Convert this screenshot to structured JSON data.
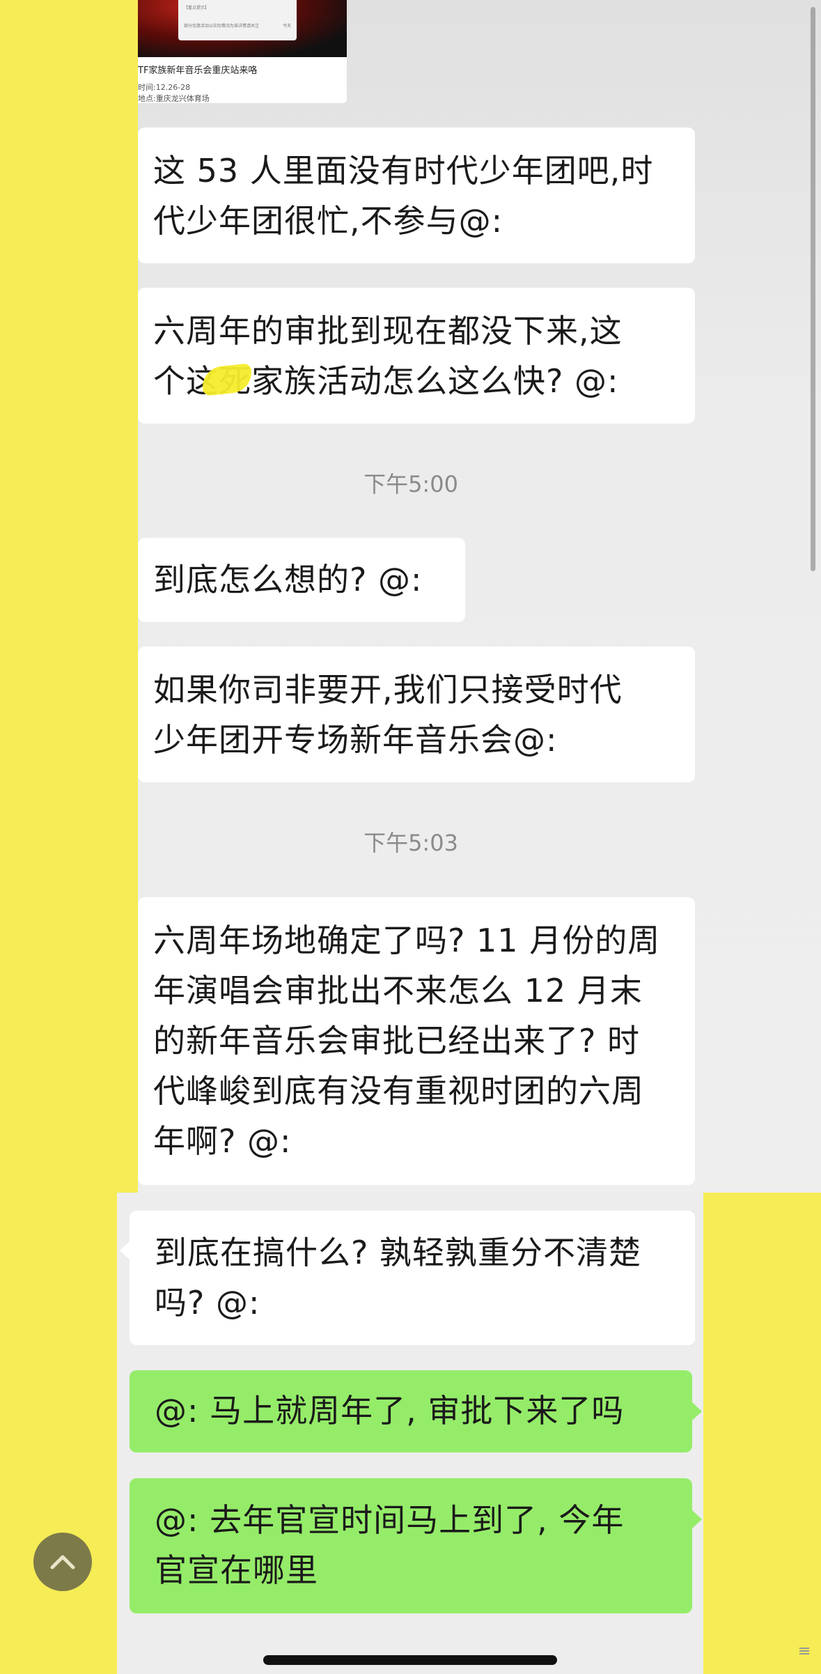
{
  "shared_card": {
    "title": "TF家族新年音乐会重庆站来咯",
    "time": "时间:12.26-28",
    "location": "地点:重庆龙兴体育场",
    "tiny_1": "【重点提示】",
    "tiny_2": "部分优惠活动以实际情况为准详情请关注",
    "tiny_3": "今天"
  },
  "messages": [
    {
      "side": "left",
      "lines": [
        "这 53 人里面没有时代少年团吧,时",
        "代少年团很忙,不参与@:"
      ]
    },
    {
      "side": "left",
      "lines": [
        "六周年的审批到现在都没下来,这",
        "个这死家族活动怎么这么快? @:"
      ]
    },
    {
      "side": "left",
      "lines": [
        "到底怎么想的? @:"
      ]
    },
    {
      "side": "left",
      "lines": [
        "如果你司非要开,我们只接受时代",
        "少年团开专场新年音乐会@:"
      ]
    },
    {
      "side": "left",
      "lines": [
        "六周年场地确定了吗? 11 月份的周",
        "年演唱会审批出不来怎么 12 月末",
        "的新年音乐会审批已经出来了? 时",
        "代峰峻到底有没有重视时团的六周",
        "年啊? @:"
      ]
    },
    {
      "side": "left",
      "lines": [
        "到底在搞什么? 孰轻孰重分不清楚",
        "吗? @:"
      ]
    },
    {
      "side": "right",
      "lines": [
        "@: 马上就周年了, 审批下来了吗"
      ]
    },
    {
      "side": "right",
      "lines": [
        "@: 去年官宣时间马上到了, 今年",
        "官宣在哪里"
      ]
    }
  ],
  "timestamps": [
    "下午5:00",
    "下午5:03"
  ],
  "icons": {
    "scroll_top": "chevron-up-icon",
    "home": "home-indicator"
  },
  "colors": {
    "background_yellow": "#f6ec55",
    "chat_bg": "#ededed",
    "bubble_white": "#ffffff",
    "bubble_green": "#95ec69"
  }
}
